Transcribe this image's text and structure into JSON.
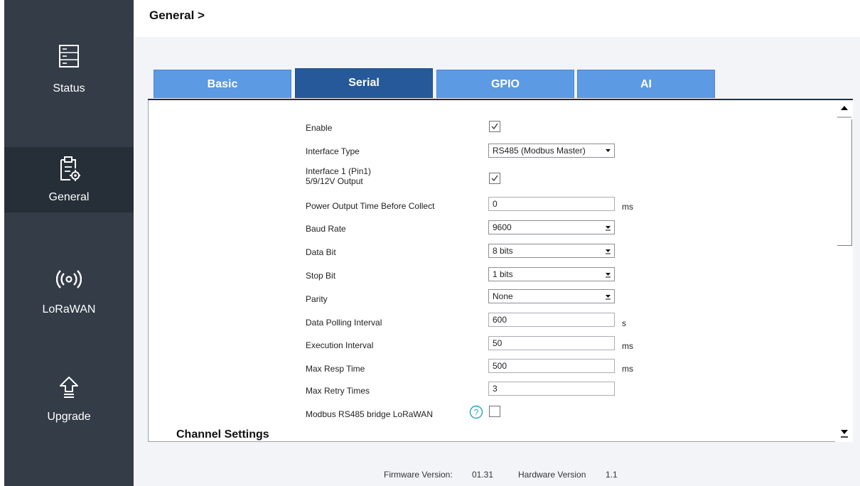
{
  "sidebar": {
    "items": [
      {
        "label": "Status",
        "icon": "status-icon"
      },
      {
        "label": "General",
        "icon": "general-icon",
        "active": true
      },
      {
        "label": "LoRaWAN",
        "icon": "lorawan-icon"
      },
      {
        "label": "Upgrade",
        "icon": "upgrade-icon"
      }
    ]
  },
  "breadcrumb": "General >",
  "tabs": [
    "Basic",
    "Serial",
    "GPIO",
    "AI"
  ],
  "active_tab": "Serial",
  "form": {
    "enable": {
      "label": "Enable",
      "checked": true
    },
    "interface_type": {
      "label": "Interface Type",
      "value": "RS485 (Modbus Master)"
    },
    "interface_output": {
      "label_line1": "Interface 1 (Pin1)",
      "label_line2": "5/9/12V Output",
      "checked": true
    },
    "power_output_time": {
      "label": "Power Output Time Before Collect",
      "value": "0",
      "unit": "ms"
    },
    "baud_rate": {
      "label": "Baud Rate",
      "value": "9600"
    },
    "data_bit": {
      "label": "Data Bit",
      "value": "8 bits"
    },
    "stop_bit": {
      "label": "Stop Bit",
      "value": "1 bits"
    },
    "parity": {
      "label": "Parity",
      "value": "None"
    },
    "data_polling_interval": {
      "label": "Data Polling Interval",
      "value": "600",
      "unit": "s"
    },
    "execution_interval": {
      "label": "Execution Interval",
      "value": "50",
      "unit": "ms"
    },
    "max_resp_time": {
      "label": "Max Resp Time",
      "value": "500",
      "unit": "ms"
    },
    "max_retry_times": {
      "label": "Max Retry Times",
      "value": "3"
    },
    "modbus_bridge": {
      "label": "Modbus RS485 bridge LoRaWAN",
      "checked": false
    }
  },
  "section_title": "Channel Settings",
  "footer": {
    "firmware_label": "Firmware Version:",
    "firmware_value": "01.31",
    "hardware_label": "Hardware Version",
    "hardware_value": "1.1"
  },
  "colors": {
    "sidebar": "#333c47",
    "sidebar_active": "#262e37",
    "tab": "#5c9ae3",
    "tab_active": "#255999",
    "help": "#2aa4b5"
  }
}
